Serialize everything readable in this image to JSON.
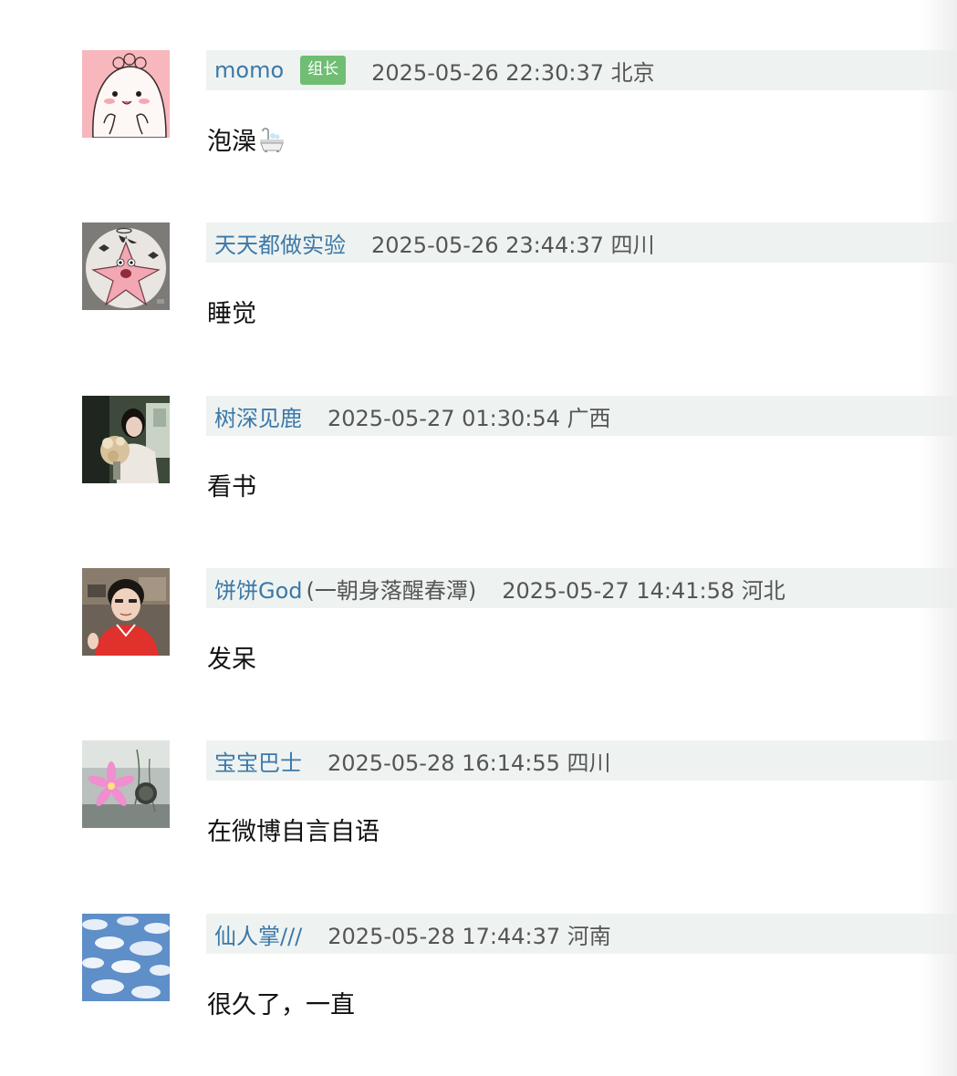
{
  "comments": [
    {
      "author": "momo",
      "author_extra": "",
      "badge": "组长",
      "time": "2025-05-26 22:30:37 北京",
      "body": "泡澡",
      "body_icon": "bathtub-icon",
      "avatar": "cartoon-dinosaur-avatar"
    },
    {
      "author": "天天都做实验",
      "author_extra": "",
      "badge": "",
      "time": "2025-05-26 23:44:37 四川",
      "body": "睡觉",
      "body_icon": "",
      "avatar": "cartoon-starfish-avatar"
    },
    {
      "author": "树深见鹿",
      "author_extra": "",
      "badge": "",
      "time": "2025-05-27 01:30:54 广西",
      "body": "看书",
      "body_icon": "",
      "avatar": "photo-woman-flowers-avatar"
    },
    {
      "author": "饼饼God",
      "author_extra": "(一朝身落醒春潭)",
      "badge": "",
      "time": "2025-05-27 14:41:58 河北",
      "body": "发呆",
      "body_icon": "",
      "avatar": "photo-man-red-shirt-avatar"
    },
    {
      "author": "宝宝巴士",
      "author_extra": "",
      "badge": "",
      "time": "2025-05-28 16:14:55 四川",
      "body": "在微博自言自语",
      "body_icon": "",
      "avatar": "photo-pink-flower-avatar"
    },
    {
      "author": "仙人掌///",
      "author_extra": "",
      "badge": "",
      "time": "2025-05-28 17:44:37 河南",
      "body": "很久了，一直",
      "body_icon": "",
      "avatar": "photo-cloudy-sky-avatar"
    }
  ],
  "colors": {
    "author_link": "#3c78a8",
    "meta_bar_bg": "#eef3f1",
    "badge_bg": "#6fbe73",
    "time_text": "#555555",
    "body_text": "#111111"
  }
}
